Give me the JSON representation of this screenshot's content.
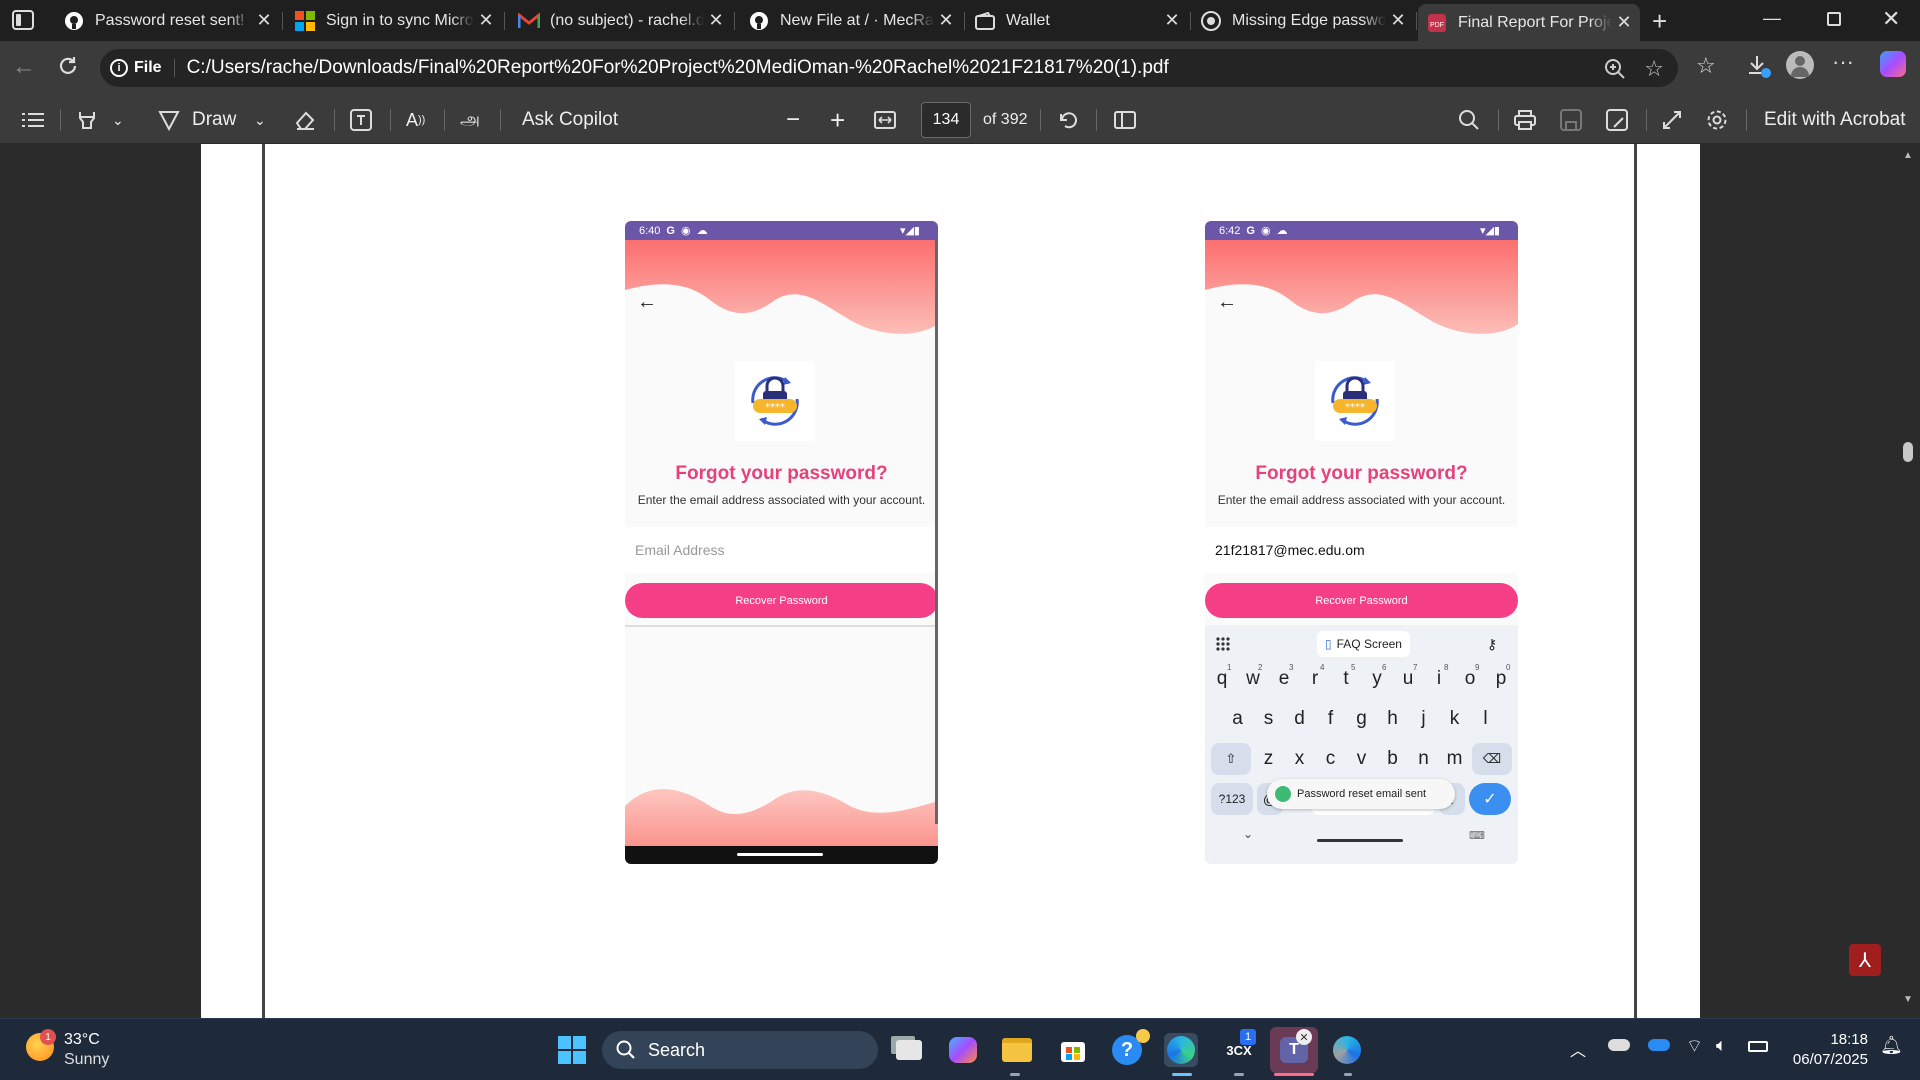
{
  "tabs": [
    {
      "title": "Password reset sent! · G",
      "icon": "github-icon"
    },
    {
      "title": "Sign in to sync Microsoft",
      "icon": "microsoft-icon"
    },
    {
      "title": "(no subject) - rachel.ds",
      "icon": "gmail-icon"
    },
    {
      "title": "New File at / · MecRach",
      "icon": "github-icon"
    },
    {
      "title": "Wallet",
      "icon": "wallet-icon"
    },
    {
      "title": "Missing Edge password",
      "icon": "edge-help-icon"
    },
    {
      "title": "Final Report For Project",
      "icon": "pdf-icon",
      "active": true
    }
  ],
  "address": {
    "scheme_label": "File",
    "url": "C:/Users/rache/Downloads/Final%20Report%20For%20Project%20MediOman-%20Rachel%2021F21817%20(1).pdf"
  },
  "pdf_toolbar": {
    "draw_label": "Draw",
    "copilot_label": "Ask Copilot",
    "page_number": "134",
    "page_total": "of 392",
    "acrobat_label": "Edit with Acrobat"
  },
  "phone_left": {
    "time": "6:40",
    "status_icons": "G",
    "title": "Forgot your password?",
    "subtitle": "Enter the email address associated with your account.",
    "email_placeholder": "Email Address",
    "button": "Recover Password"
  },
  "phone_right": {
    "time": "6:42",
    "status_icons": "G",
    "title": "Forgot your password?",
    "subtitle": "Enter the email address associated with your account.",
    "email_value": "21f21817@mec.edu.om",
    "button": "Recover Password",
    "keyboard": {
      "suggestion": "FAQ Screen",
      "row1": [
        "q",
        "w",
        "e",
        "r",
        "t",
        "y",
        "u",
        "i",
        "o",
        "p"
      ],
      "row1_nums": [
        "1",
        "2",
        "3",
        "4",
        "5",
        "6",
        "7",
        "8",
        "9",
        "0"
      ],
      "row2": [
        "a",
        "s",
        "d",
        "f",
        "g",
        "h",
        "j",
        "k",
        "l"
      ],
      "row3": [
        "z",
        "x",
        "c",
        "v",
        "b",
        "n",
        "m"
      ],
      "sym_key": "?123",
      "at_key": "@",
      "period_key": "."
    },
    "toast": "Password reset email sent"
  },
  "taskbar": {
    "weather_temp": "33°C",
    "weather_desc": "Sunny",
    "weather_badge": "1",
    "search_label": "Search",
    "time": "18:18",
    "date": "06/07/2025",
    "app_badge": "1"
  },
  "colors": {
    "accent_pink": "#f43f86",
    "title_pink": "#e8407a",
    "status_purple": "#6b56a8"
  }
}
